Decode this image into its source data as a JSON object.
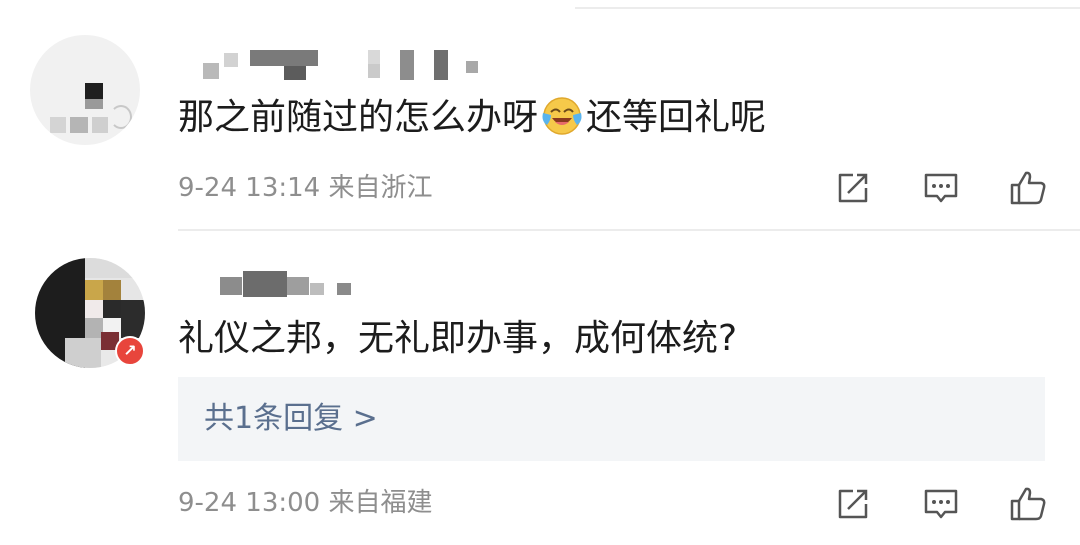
{
  "comments": [
    {
      "text_before_emoji": "那之前随过的怎么办呀",
      "emoji": "laughing-crying-emoji",
      "text_after_emoji": "还等回礼呢",
      "date": "9-24",
      "time": "13:14",
      "location": "来自浙江"
    },
    {
      "text": "礼仪之邦，无礼即办事，成何体统?",
      "reply_summary": "共1条回复 >",
      "date": "9-24",
      "time": "13:00",
      "location": "来自福建"
    }
  ],
  "icons": {
    "share": "share-icon",
    "comment": "comment-icon",
    "like": "like-icon"
  },
  "colors": {
    "text": "#1c1c1c",
    "meta": "#8e8e8e",
    "reply_link": "#5a6f8e",
    "reply_bg": "#f3f5f7",
    "badge": "#e8453c"
  }
}
